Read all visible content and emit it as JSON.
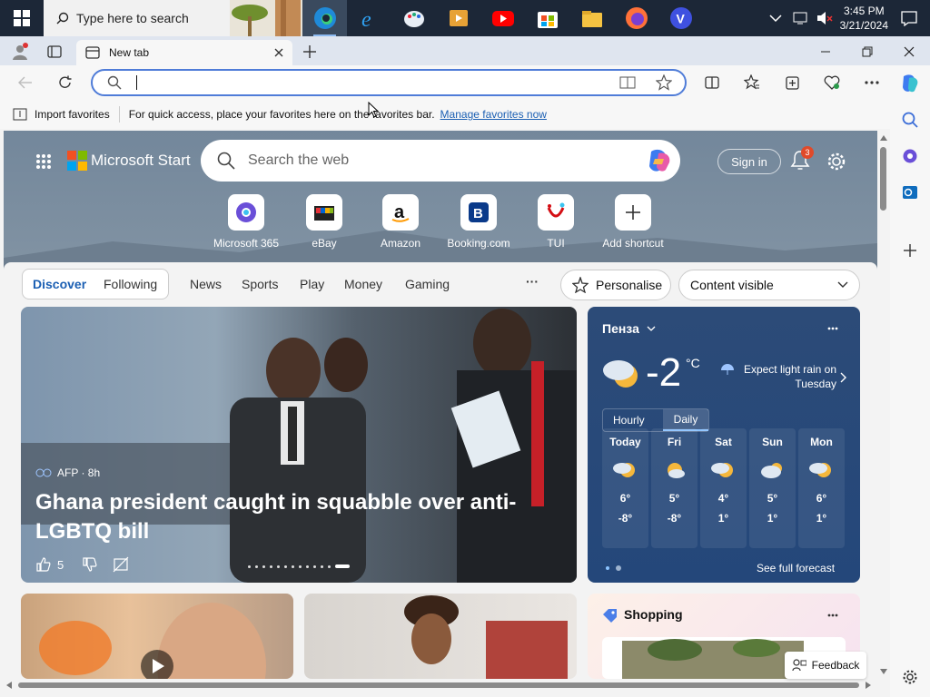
{
  "taskbar": {
    "search_placeholder": "Type here to search",
    "time": "3:45 PM",
    "date": "3/21/2024",
    "apps": [
      "edge-icon",
      "ie-icon",
      "paint-icon",
      "video-editor-icon",
      "youtube-icon",
      "store-icon",
      "file-explorer-icon",
      "firefox-icon",
      "v-app-icon"
    ]
  },
  "browser": {
    "tab_title": "New tab",
    "address_value": "",
    "import_favorites": "Import favorites",
    "fav_hint": "For quick access, place your favorites here on the favorites bar.",
    "manage_link": "Manage favorites now"
  },
  "start": {
    "brand": "Microsoft Start",
    "search_placeholder": "Search the web",
    "sign_in": "Sign in",
    "notification_count": "3",
    "shortcuts": [
      {
        "label": "Microsoft 365"
      },
      {
        "label": "eBay"
      },
      {
        "label": "Amazon"
      },
      {
        "label": "Booking.com"
      },
      {
        "label": "TUI"
      },
      {
        "label": "Add shortcut"
      }
    ]
  },
  "feed_nav": {
    "discover": "Discover",
    "following": "Following",
    "items": [
      "News",
      "Sports",
      "Play",
      "Money",
      "Gaming"
    ],
    "more": "···",
    "personalise": "Personalise",
    "content_visible": "Content visible"
  },
  "hero": {
    "source": "AFP · 8h",
    "title": "Ghana president caught in squabble over anti-LGBTQ bill",
    "likes": "5"
  },
  "weather": {
    "location": "Пенза",
    "temp": "-2",
    "unit": "°C",
    "alert": "Expect light rain on Tuesday",
    "tab_hourly": "Hourly",
    "tab_daily": "Daily",
    "days": [
      {
        "name": "Today",
        "hi": "6°",
        "lo": "-8°"
      },
      {
        "name": "Fri",
        "hi": "5°",
        "lo": "-8°"
      },
      {
        "name": "Sat",
        "hi": "4°",
        "lo": "1°"
      },
      {
        "name": "Sun",
        "hi": "5°",
        "lo": "1°"
      },
      {
        "name": "Mon",
        "hi": "6°",
        "lo": "1°"
      }
    ],
    "full_forecast": "See full forecast"
  },
  "shopping": {
    "title": "Shopping"
  },
  "feedback": "Feedback",
  "colors": {
    "accent": "#1b5fb3",
    "taskbar": "#1c2737",
    "weather_bg": "#2c4b78"
  }
}
